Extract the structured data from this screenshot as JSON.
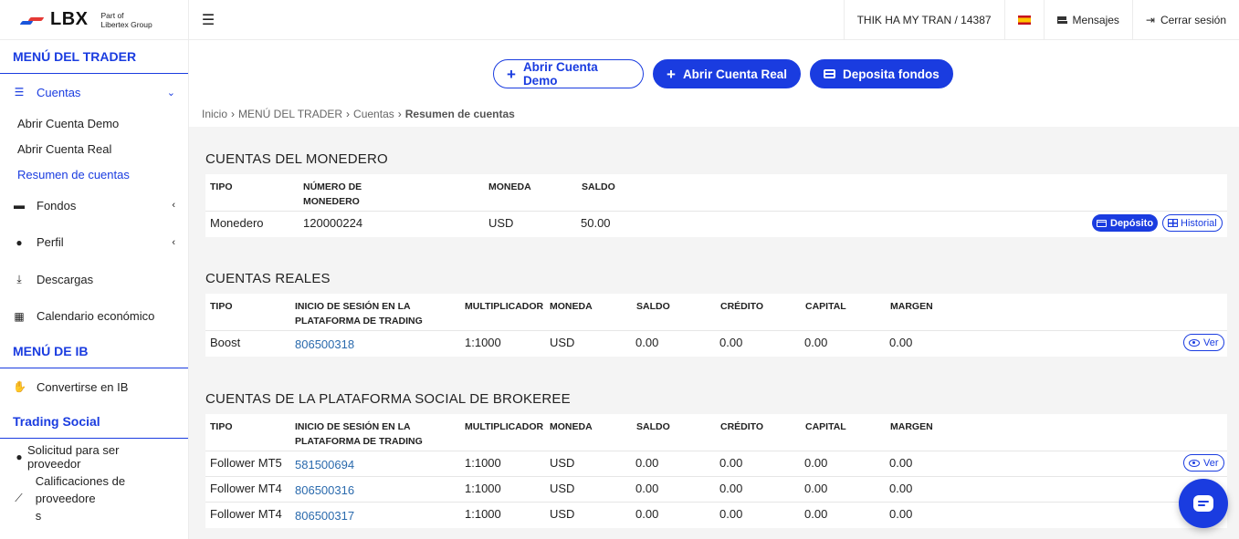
{
  "brand": {
    "logo": "LBX",
    "sub_line1": "Part of",
    "sub_line2": "Libertex Group"
  },
  "header": {
    "menu_icon": "hamburger-icon",
    "user": "THIK HA MY TRAN / 14387",
    "language_flag": "spain-flag-icon",
    "messages": "Mensajes",
    "logout": "Cerrar sesión"
  },
  "sidebar": {
    "trader_title": "MENÚ DEL TRADER",
    "cuentas": "Cuentas",
    "sub": [
      "Abrir Cuenta Demo",
      "Abrir Cuenta Real",
      "Resumen de cuentas"
    ],
    "fondos": "Fondos",
    "perfil": "Perfil",
    "descargas": "Descargas",
    "calendario": "Calendario económico",
    "ib_title": "MENÚ DE IB",
    "convertirse": "Convertirse en IB",
    "social_title": "Trading Social",
    "solicitud": "Solicitud para ser proveedor",
    "calificaciones_1": "Calificaciones de proveedore",
    "calificaciones_2": "s"
  },
  "actions": {
    "demo": "Abrir Cuenta Demo",
    "real": "Abrir Cuenta Real",
    "deposit": "Deposita fondos"
  },
  "breadcrumb": {
    "home": "Inicio",
    "menu": "MENÚ DEL TRADER",
    "accounts": "Cuentas",
    "current": "Resumen de cuentas"
  },
  "wallet": {
    "title": "CUENTAS DEL MONEDERO",
    "headers": {
      "tipo": "TIPO",
      "numero_1": "NÚMERO DE",
      "numero_2": "MONEDERO",
      "moneda": "MONEDA",
      "saldo": "SALDO"
    },
    "row": {
      "tipo": "Monedero",
      "numero": "120000224",
      "moneda": "USD",
      "saldo": "50.00",
      "btn_deposit": "Depósito",
      "btn_history": "Historial"
    }
  },
  "real": {
    "title": "CUENTAS REALES",
    "headers": {
      "tipo": "TIPO",
      "login_1": "INICIO DE SESIÓN EN LA",
      "login_2": "PLATAFORMA DE TRADING",
      "mult": "MULTIPLICADOR",
      "moneda": "MONEDA",
      "saldo": "SALDO",
      "credito": "CRÉDITO",
      "capital": "CAPITAL",
      "margen": "MARGEN"
    },
    "row": {
      "tipo": "Boost",
      "login": "806500318",
      "mult": "1:1000",
      "moneda": "USD",
      "saldo": "0.00",
      "credito": "0.00",
      "capital": "0.00",
      "margen": "0.00",
      "btn": "Ver"
    }
  },
  "social": {
    "title": "CUENTAS DE LA PLATAFORMA SOCIAL DE BROKEREE",
    "headers": {
      "tipo": "TIPO",
      "login_1": "INICIO DE SESIÓN EN LA",
      "login_2": "PLATAFORMA DE TRADING",
      "mult": "MULTIPLICADOR",
      "moneda": "MONEDA",
      "saldo": "SALDO",
      "credito": "CRÉDITO",
      "capital": "CAPITAL",
      "margen": "MARGEN"
    },
    "rows": [
      {
        "tipo": "Follower MT5",
        "login": "581500694",
        "mult": "1:1000",
        "moneda": "USD",
        "saldo": "0.00",
        "credito": "0.00",
        "capital": "0.00",
        "margen": "0.00",
        "btn": "Ver"
      },
      {
        "tipo": "Follower MT4",
        "login": "806500316",
        "mult": "1:1000",
        "moneda": "USD",
        "saldo": "0.00",
        "credito": "0.00",
        "capital": "0.00",
        "margen": "0.00"
      },
      {
        "tipo": "Follower MT4",
        "login": "806500317",
        "mult": "1:1000",
        "moneda": "USD",
        "saldo": "0.00",
        "credito": "0.00",
        "capital": "0.00",
        "margen": "0.00"
      }
    ]
  },
  "colors": {
    "accent": "#1a3ce0",
    "link": "#2a6aad",
    "content_bg": "#f4f4f4"
  }
}
